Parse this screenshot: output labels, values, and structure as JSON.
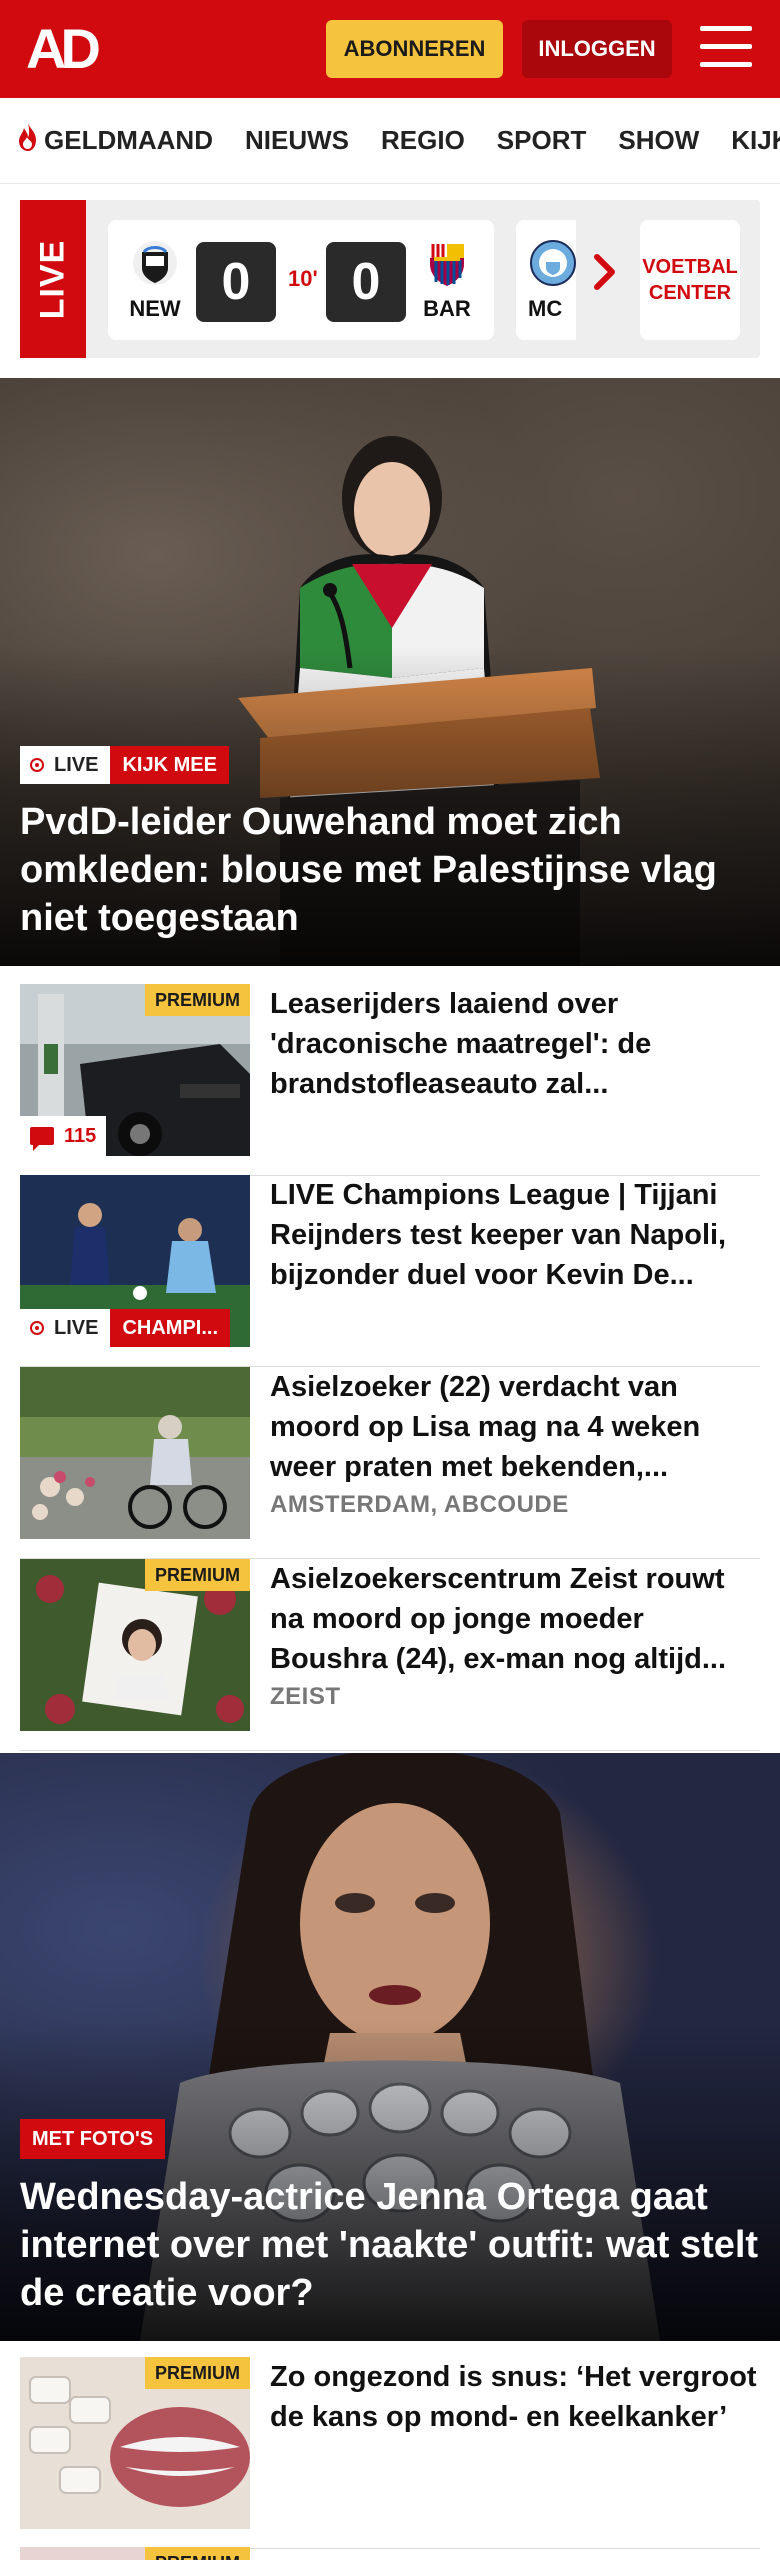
{
  "header": {
    "logo": "AD",
    "subscribe_label": "ABONNEREN",
    "login_label": "INLOGGEN"
  },
  "nav": {
    "items": [
      "GELDMAAND",
      "NIEUWS",
      "REGIO",
      "SPORT",
      "SHOW",
      "KIJK"
    ]
  },
  "live": {
    "tag": "LIVE",
    "match": {
      "home_team": "NEW",
      "home_score": "0",
      "minute": "10'",
      "away_score": "0",
      "away_team": "BAR"
    },
    "next_team": "MC",
    "voetbal_center_line1": "VOETBAL",
    "voetbal_center_line2": "CENTER"
  },
  "hero": {
    "live_label": "LIVE",
    "kijk_mee_label": "KIJK MEE",
    "title": "PvdD-leider Ouwehand moet zich omkleden: blouse met Palestijnse vlag niet toegestaan"
  },
  "articles": [
    {
      "premium": "PREMIUM",
      "comments": "115",
      "title": "Leaserijders laaiend over 'draconische maatregel': de brandstofleaseauto zal..."
    },
    {
      "live_label": "LIVE",
      "category": "CHAMPI...",
      "title": "LIVE Champions League | Tijjani Reijnders test keeper van Napoli, bijzonder duel voor Kevin De..."
    },
    {
      "title": "Asielzoeker (22) verdacht van moord op Lisa mag na 4 weken weer praten met bekenden,...",
      "location": "AMSTERDAM, ABCOUDE"
    },
    {
      "premium": "PREMIUM",
      "title": "Asielzoekerscentrum Zeist rouwt na moord op jonge moeder Boushra (24), ex-man nog altijd...",
      "location": "ZEIST"
    }
  ],
  "hero2": {
    "badge": "MET FOTO'S",
    "title": "Wednesday-actrice Jenna Ortega gaat internet over met 'naakte' outfit: wat stelt de creatie voor?"
  },
  "articles2": [
    {
      "premium": "PREMIUM",
      "title": "Zo ongezond is snus: ‘Het vergroot de kans op mond- en keelkanker’"
    },
    {
      "premium": "PREMIUM"
    }
  ],
  "colors": {
    "brand_red": "#d10a10",
    "premium_yellow": "#f6c33f"
  }
}
